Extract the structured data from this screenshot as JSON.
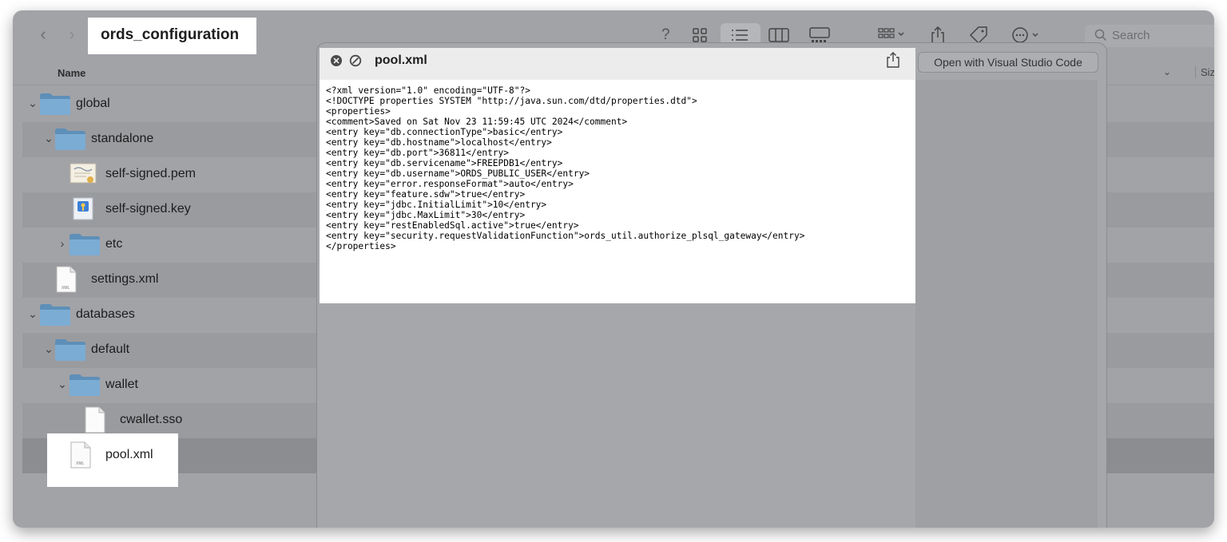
{
  "toolbar": {
    "back_icon": "chevron-left-icon",
    "forward_icon": "chevron-right-icon",
    "folder_title": "ords_configuration",
    "help_glyph": "?",
    "search_placeholder": "Search"
  },
  "columns": {
    "name": "Name",
    "size": "Size"
  },
  "files": [
    {
      "name": "global",
      "kind": "folder",
      "expanded": true
    },
    {
      "name": "standalone",
      "kind": "folder",
      "expanded": true
    },
    {
      "name": "self-signed.pem",
      "kind": "certificate"
    },
    {
      "name": "self-signed.key",
      "kind": "key"
    },
    {
      "name": "etc",
      "kind": "folder",
      "expanded": false
    },
    {
      "name": "settings.xml",
      "kind": "xml-file"
    },
    {
      "name": "databases",
      "kind": "folder",
      "expanded": true
    },
    {
      "name": "default",
      "kind": "folder",
      "expanded": true
    },
    {
      "name": "wallet",
      "kind": "folder",
      "expanded": true
    },
    {
      "name": "cwallet.sso",
      "kind": "file"
    },
    {
      "name": "pool.xml",
      "kind": "xml-file",
      "selected": true
    }
  ],
  "quicklook": {
    "filename": "pool.xml",
    "open_button": "Open with Visual Studio Code",
    "content": "<?xml version=\"1.0\" encoding=\"UTF-8\"?>\n<!DOCTYPE properties SYSTEM \"http://java.sun.com/dtd/properties.dtd\">\n<properties>\n<comment>Saved on Sat Nov 23 11:59:45 UTC 2024</comment>\n<entry key=\"db.connectionType\">basic</entry>\n<entry key=\"db.hostname\">localhost</entry>\n<entry key=\"db.port\">36811</entry>\n<entry key=\"db.servicename\">FREEPDB1</entry>\n<entry key=\"db.username\">ORDS_PUBLIC_USER</entry>\n<entry key=\"error.responseFormat\">auto</entry>\n<entry key=\"feature.sdw\">true</entry>\n<entry key=\"jdbc.InitialLimit\">10</entry>\n<entry key=\"jdbc.MaxLimit\">30</entry>\n<entry key=\"restEnabledSql.active\">true</entry>\n<entry key=\"security.requestValidationFunction\">ords_util.authorize_plsql_gateway</entry>\n</properties>"
  },
  "icon_labels": {
    "xml_badge": "XML"
  }
}
